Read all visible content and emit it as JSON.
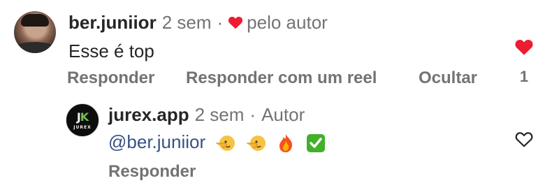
{
  "comments": [
    {
      "username": "ber.juniior",
      "time": "2 sem",
      "separator": "·",
      "author_badge": "pelo autor",
      "text": "Esse é top",
      "actions": {
        "reply": "Responder",
        "reply_reel": "Responder com um reel",
        "hide": "Ocultar"
      },
      "liked": true,
      "like_count": "1",
      "like_color": "#ed1c30"
    },
    {
      "username": "jurex.app",
      "time": "2 sem",
      "separator": "·",
      "author_label": "Autor",
      "avatar_monogram": "JK",
      "avatar_tag": "JUREX",
      "mention": "@ber.juniior",
      "emojis": [
        "pointing-face-emoji",
        "pointing-face-emoji",
        "fire-emoji",
        "check-mark-button-emoji"
      ],
      "actions": {
        "reply": "Responder"
      },
      "liked": false
    }
  ],
  "colors": {
    "mention": "#385185",
    "muted": "#737373",
    "text": "#262626",
    "like": "#ed1c30"
  }
}
